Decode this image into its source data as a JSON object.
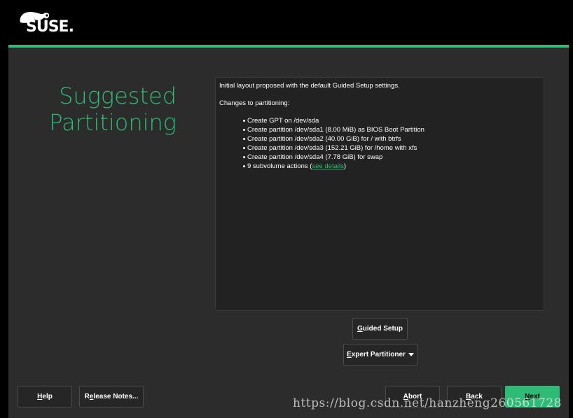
{
  "header": {
    "logo_text": "SUSE."
  },
  "page": {
    "title_line1": "Suggested",
    "title_line2": "Partitioning"
  },
  "summary": {
    "intro": "Initial layout proposed with the default Guided Setup settings.",
    "changes_heading": "Changes to partitioning:",
    "items": [
      "Create GPT on /dev/sda",
      "Create partition /dev/sda1 (8.00 MiB) as BIOS Boot Partition",
      "Create partition /dev/sda2 (40.00 GiB) for / with btrfs",
      "Create partition /dev/sda3 (152.21 GiB) for /home with xfs",
      "Create partition /dev/sda4 (7.78 GiB) for swap"
    ],
    "subvolume_prefix": "9 subvolume actions (",
    "subvolume_link": "see details",
    "subvolume_suffix": ")"
  },
  "buttons": {
    "guided_setup_first": "G",
    "guided_setup_rest": "uided Setup",
    "expert_first": "E",
    "expert_rest": "xpert Partitioner",
    "help_first": "H",
    "help_rest": "elp",
    "release_notes_pre": "R",
    "release_notes_u": "e",
    "release_notes_rest": "lease Notes...",
    "abort_first": "A",
    "abort_rest": "bort",
    "back_first": "B",
    "back_rest": "ack",
    "next_first": "N",
    "next_rest": "ext"
  },
  "colors": {
    "accent": "#30ba78",
    "background": "#2c2c2c"
  },
  "watermark": "https://blog.csdn.net/hanzheng260561728"
}
